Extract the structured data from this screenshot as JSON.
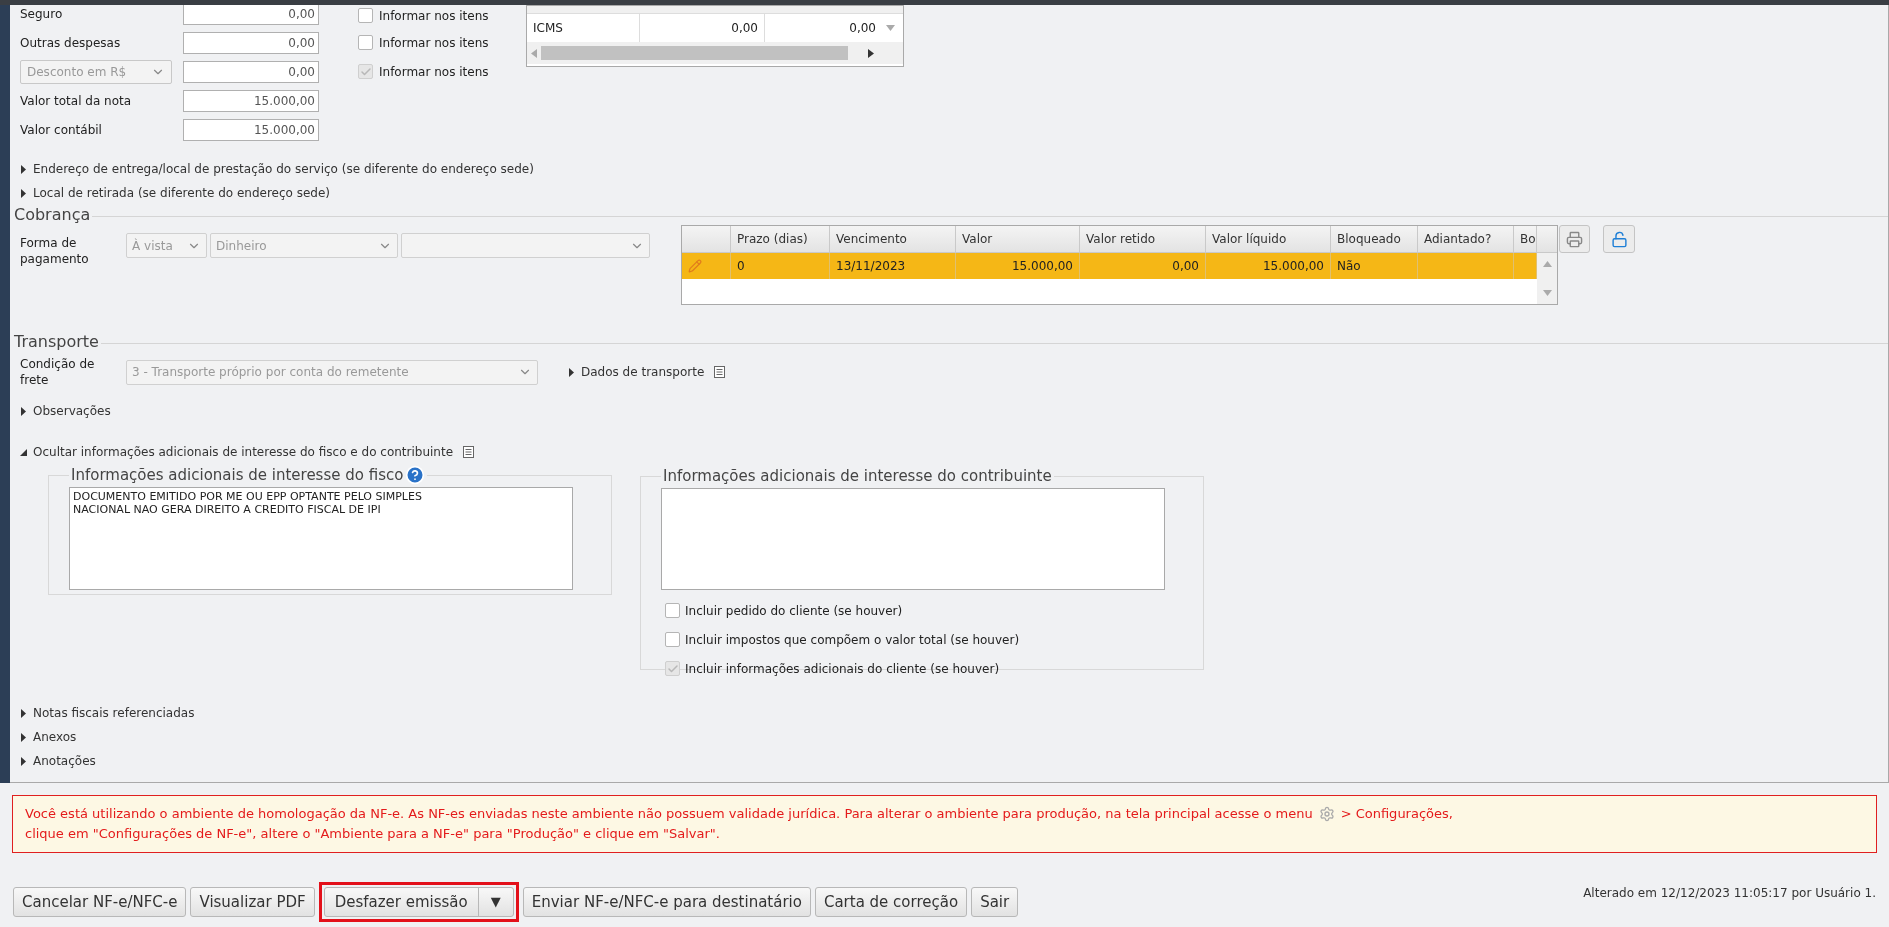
{
  "totals": [
    {
      "kind": "label",
      "label": "Seguro",
      "value": "0,00"
    },
    {
      "kind": "label",
      "label": "Outras despesas",
      "value": "0,00"
    },
    {
      "kind": "select",
      "label": "Desconto em R$",
      "value": "0,00"
    },
    {
      "kind": "label",
      "label": "Valor total da nota",
      "value": "15.000,00"
    },
    {
      "kind": "label",
      "label": "Valor contábil",
      "value": "15.000,00"
    }
  ],
  "item_checkboxes": [
    {
      "label": "Informar nos itens",
      "checked": false,
      "disabled": false
    },
    {
      "label": "Informar nos itens",
      "checked": false,
      "disabled": false
    },
    {
      "label": "Informar nos itens",
      "checked": true,
      "disabled": true
    }
  ],
  "tax_table": {
    "rows": [
      {
        "name": "ICMS",
        "column_2": "0,00",
        "column_3": "0,00"
      }
    ]
  },
  "top_expanders": [
    {
      "label": "Endereço de entrega/local de prestação do serviço (se diferente do endereço sede)",
      "expanded": false
    },
    {
      "label": "Local de retirada (se diferente do endereço sede)",
      "expanded": false
    }
  ],
  "cobranca": {
    "title": "Cobrança",
    "payment_label": "Forma de pagamento",
    "selects": [
      {
        "value": "À vista",
        "disabled": true
      },
      {
        "value": "Dinheiro",
        "disabled": true
      },
      {
        "disabled": true
      }
    ],
    "grid": {
      "columns": [
        "Prazo (dias)",
        "Vencimento",
        "Valor",
        "Valor retido",
        "Valor líquido",
        "Bloqueado",
        "Adiantado?",
        "Bo"
      ],
      "rows": [
        {
          "selected": true,
          "cells": [
            "0",
            "13/11/2023",
            "15.000,00",
            "0,00",
            "15.000,00",
            "Não",
            "",
            ""
          ]
        }
      ]
    }
  },
  "transporte": {
    "title": "Transporte",
    "freight_label": "Condição de frete",
    "freight_value": "3 - Transporte próprio por conta do remetente",
    "details": {
      "label": "Dados de transporte",
      "expanded": false
    }
  },
  "observacoes": {
    "label": "Observações",
    "expanded": false
  },
  "additional_info": {
    "label": "Ocultar informações adicionais de interesse do fisco e do contribuinte",
    "expanded": true,
    "fisco": {
      "title": "Informações adicionais de interesse do fisco",
      "text": "DOCUMENTO EMITIDO POR ME OU EPP OPTANTE PELO SIMPLES\nNACIONAL NAO GERA DIREITO A CREDITO FISCAL DE IPI"
    },
    "contribuinte": {
      "title": "Informações adicionais de interesse do contribuinte",
      "options": [
        {
          "label": "Incluir pedido do cliente (se houver)",
          "checked": false,
          "disabled": false
        },
        {
          "label": "Incluir impostos que compõem o valor total (se houver)",
          "checked": false,
          "disabled": false
        },
        {
          "label": "Incluir informações adicionais do cliente (se houver)",
          "checked": true,
          "disabled": true
        }
      ]
    }
  },
  "bottom_expanders": [
    {
      "label": "Notas fiscais referenciadas",
      "expanded": false
    },
    {
      "label": "Anexos",
      "expanded": false
    },
    {
      "label": "Anotações",
      "expanded": false
    }
  ],
  "warning": {
    "before_icon": "Você está utilizando o ambiente de homologação da NF-e. As NF-es enviadas neste ambiente não possuem validade jurídica. Para alterar o ambiente para produção, na tela principal acesse o menu",
    "after_icon": "> Configurações,",
    "second_line": "clique em \"Configurações de NF-e\", altere o \"Ambiente para a NF-e\" para \"Produção\" e clique em \"Salvar\"."
  },
  "actions": [
    {
      "kind": "button",
      "label": "Cancelar NF-e/NFC-e",
      "highlighted": false
    },
    {
      "kind": "button",
      "label": "Visualizar PDF",
      "highlighted": false
    },
    {
      "kind": "split",
      "label": "Desfazer emissão",
      "menu": "▼",
      "highlighted": true
    },
    {
      "kind": "button",
      "label": "Enviar NF-e/NFC-e para destinatário",
      "highlighted": false
    },
    {
      "kind": "button",
      "label": "Carta de correção",
      "highlighted": false
    },
    {
      "kind": "button",
      "label": "Sair",
      "highlighted": false
    }
  ],
  "status": "Alterado em 12/12/2023 11:05:17 por Usuário 1."
}
